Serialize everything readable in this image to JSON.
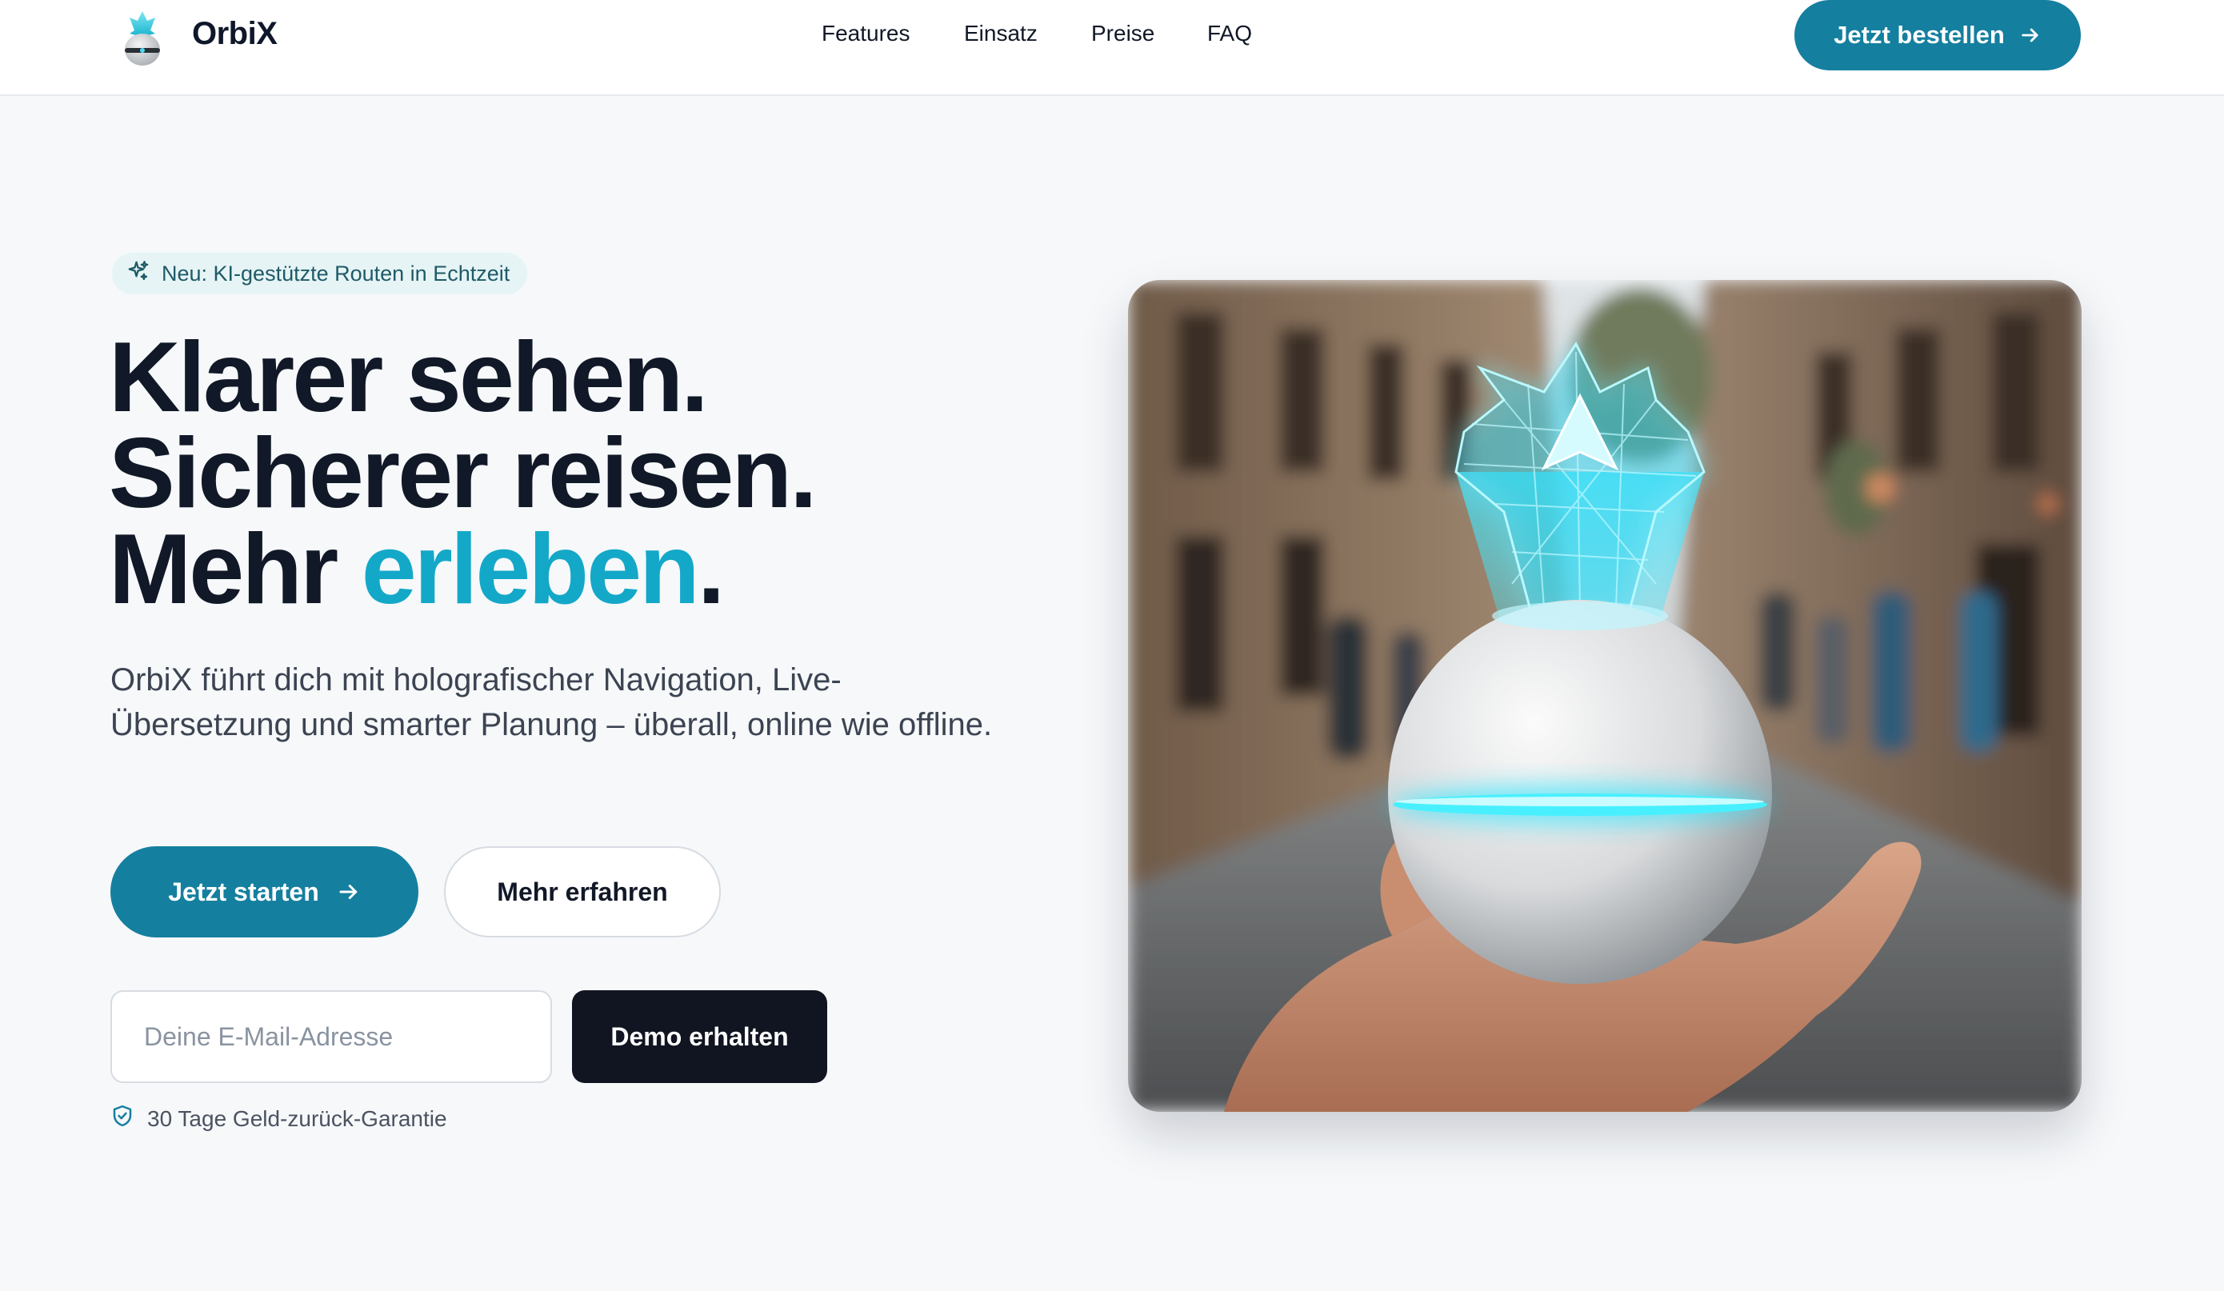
{
  "header": {
    "brand": "OrbiX",
    "logo_icon": "orbix-logo-icon",
    "nav": [
      "Features",
      "Einsatz",
      "Preise",
      "FAQ"
    ],
    "cta_label": "Jetzt bestellen"
  },
  "hero": {
    "badge": {
      "icon": "sparkles-icon",
      "text": "Neu: KI-gestützte Routen in Echtzeit"
    },
    "headline": {
      "line1": "Klarer sehen.",
      "line2": "Sicherer reisen.",
      "line3_start": "Mehr ",
      "line3_accent": "erleben",
      "line3_end": "."
    },
    "subtext": "OrbiX führt dich mit holografischer Navigation, Live-Übersetzung und smarter Planung – überall, online wie offline.",
    "primary_cta": "Jetzt starten",
    "secondary_cta": "Mehr erfahren",
    "email_placeholder": "Deine E-Mail-Adresse",
    "demo_cta": "Demo erhalten",
    "guarantee": {
      "icon": "shield-check-icon",
      "text": "30 Tage Geld-zurück-Garantie"
    }
  },
  "colors": {
    "accent": "#157f9f",
    "headline_accent": "#14a8c8",
    "dark": "#111522",
    "background": "#f6f8fa"
  }
}
